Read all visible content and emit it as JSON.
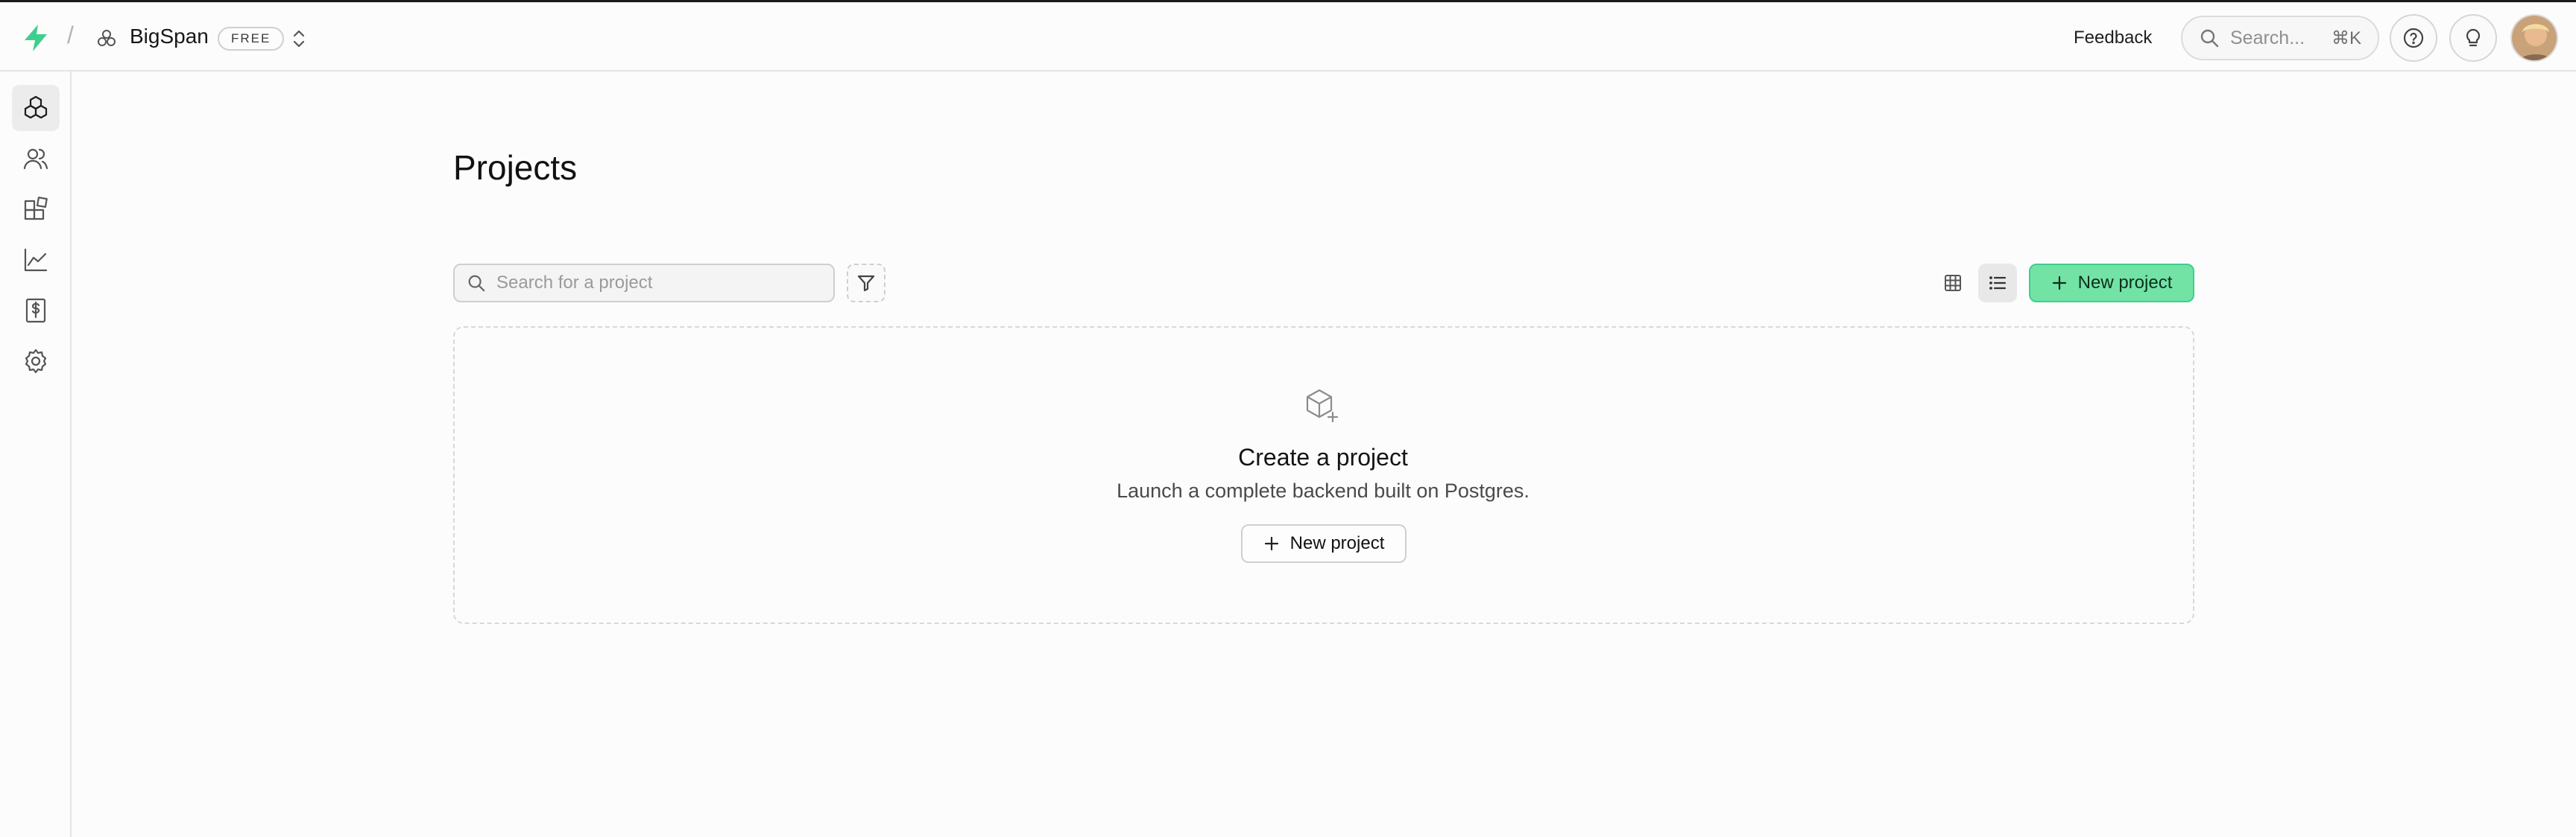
{
  "header": {
    "org_name": "BigSpan",
    "plan_badge": "FREE",
    "feedback_label": "Feedback",
    "search_placeholder": "Search...",
    "search_shortcut": "⌘K",
    "brand_color": "#3ecf8e"
  },
  "sidebar": {
    "items": [
      {
        "icon": "projects-icon",
        "active": true
      },
      {
        "icon": "users-icon",
        "active": false
      },
      {
        "icon": "integrations-icon",
        "active": false
      },
      {
        "icon": "usage-chart-icon",
        "active": false
      },
      {
        "icon": "billing-icon",
        "active": false
      },
      {
        "icon": "gear-icon",
        "active": false
      }
    ]
  },
  "main": {
    "title": "Projects",
    "search_placeholder": "Search for a project",
    "new_project_label": "New project",
    "view_modes": [
      "grid",
      "list"
    ],
    "active_view": "list",
    "empty_state": {
      "title": "Create a project",
      "description": "Launch a complete backend built on Postgres.",
      "button_label": "New project"
    }
  }
}
